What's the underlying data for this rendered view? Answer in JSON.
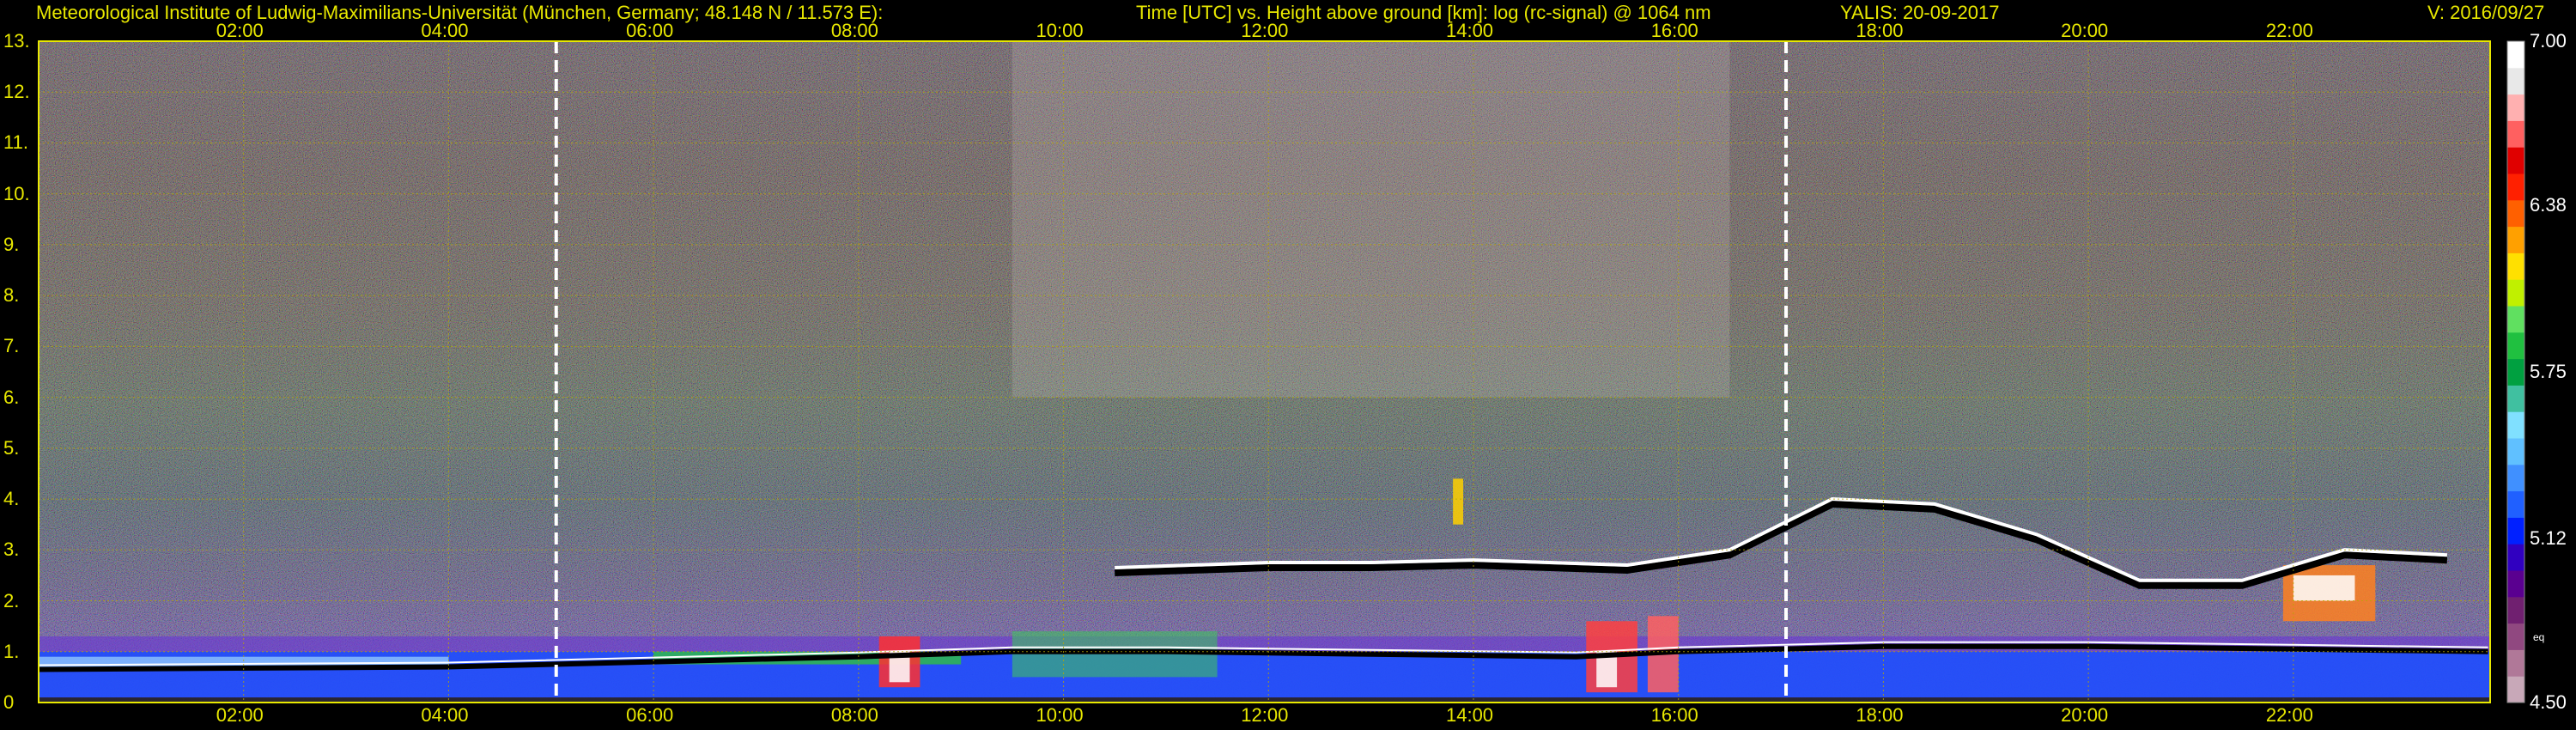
{
  "header": {
    "institute": "Meteorological Institute of Ludwig-Maximilians-Universität (München, Germany; 48.148 N / 11.573 E):",
    "plot_title": "Time [UTC] vs. Height above ground [km]: log (rc-signal) @ 1064 nm",
    "instrument_date": "YALIS: 20-09-2017",
    "version": "V: 2016/09/27"
  },
  "chart_data": {
    "type": "heatmap",
    "title": "Time [UTC] vs. Height above ground [km]: log (rc-signal) @ 1064 nm",
    "instrument": "YALIS",
    "date": "20-09-2017",
    "x_unit": "Time [UTC]",
    "y_unit": "Height above ground [km]",
    "x_tick_labels": [
      "02:00",
      "04:00",
      "06:00",
      "08:00",
      "10:00",
      "12:00",
      "14:00",
      "16:00",
      "18:00",
      "20:00",
      "22:00"
    ],
    "x_ticks_hours": [
      2,
      4,
      6,
      8,
      10,
      12,
      14,
      16,
      18,
      20,
      22
    ],
    "xlim_hours": [
      0.0,
      23.92
    ],
    "y_tick_labels": [
      "0",
      "1.",
      "2.",
      "3.",
      "4.",
      "5.",
      "6.",
      "7.",
      "8.",
      "9.",
      "10.",
      "11.",
      "12.",
      "13."
    ],
    "y_ticks_km": [
      0,
      1,
      2,
      3,
      4,
      5,
      6,
      7,
      8,
      9,
      10,
      11,
      12,
      13
    ],
    "ylim_km": [
      0,
      13
    ],
    "grid": true,
    "dashed_vertical_markers_hours": [
      5.05,
      17.05
    ],
    "colorbar": {
      "range": [
        4.5,
        7.0
      ],
      "tick_labels": [
        "7.00",
        "6.38",
        "5.75",
        "5.12",
        "4.50"
      ],
      "tick_values": [
        7.0,
        6.38,
        5.75,
        5.12,
        4.5
      ],
      "unit_label": "eq",
      "colors": [
        "#c8a8b8",
        "#b07898",
        "#904880",
        "#702070",
        "#5a0090",
        "#3000c0",
        "#0020ff",
        "#2060ff",
        "#4090ff",
        "#60c0ff",
        "#80e0ff",
        "#40c0a0",
        "#00a040",
        "#20c040",
        "#60e060",
        "#c0f000",
        "#ffe000",
        "#ffa000",
        "#ff6000",
        "#ff2000",
        "#e00000",
        "#ff6060",
        "#ffb0b0",
        "#e8e8e8",
        "#ffffff"
      ]
    },
    "features": [
      {
        "name": "boundary layer / aerosol layer top",
        "points": [
          [
            0,
            0.65
          ],
          [
            4,
            0.7
          ],
          [
            6,
            0.8
          ],
          [
            8,
            0.9
          ],
          [
            9.5,
            1.0
          ],
          [
            11,
            1.0
          ],
          [
            13,
            0.95
          ],
          [
            15,
            0.9
          ],
          [
            16,
            1.0
          ],
          [
            18,
            1.1
          ],
          [
            20,
            1.1
          ],
          [
            22,
            1.05
          ],
          [
            23.9,
            1.0
          ]
        ]
      },
      {
        "name": "cloud layer",
        "points": [
          [
            10.5,
            2.55
          ],
          [
            12,
            2.65
          ],
          [
            13,
            2.65
          ],
          [
            14,
            2.7
          ],
          [
            15.5,
            2.6
          ],
          [
            16.5,
            2.9
          ],
          [
            17.5,
            3.9
          ],
          [
            18.5,
            3.8
          ],
          [
            19.5,
            3.2
          ],
          [
            20.5,
            2.3
          ],
          [
            21.5,
            2.3
          ],
          [
            22.5,
            2.9
          ],
          [
            23.5,
            2.8
          ]
        ]
      }
    ]
  }
}
